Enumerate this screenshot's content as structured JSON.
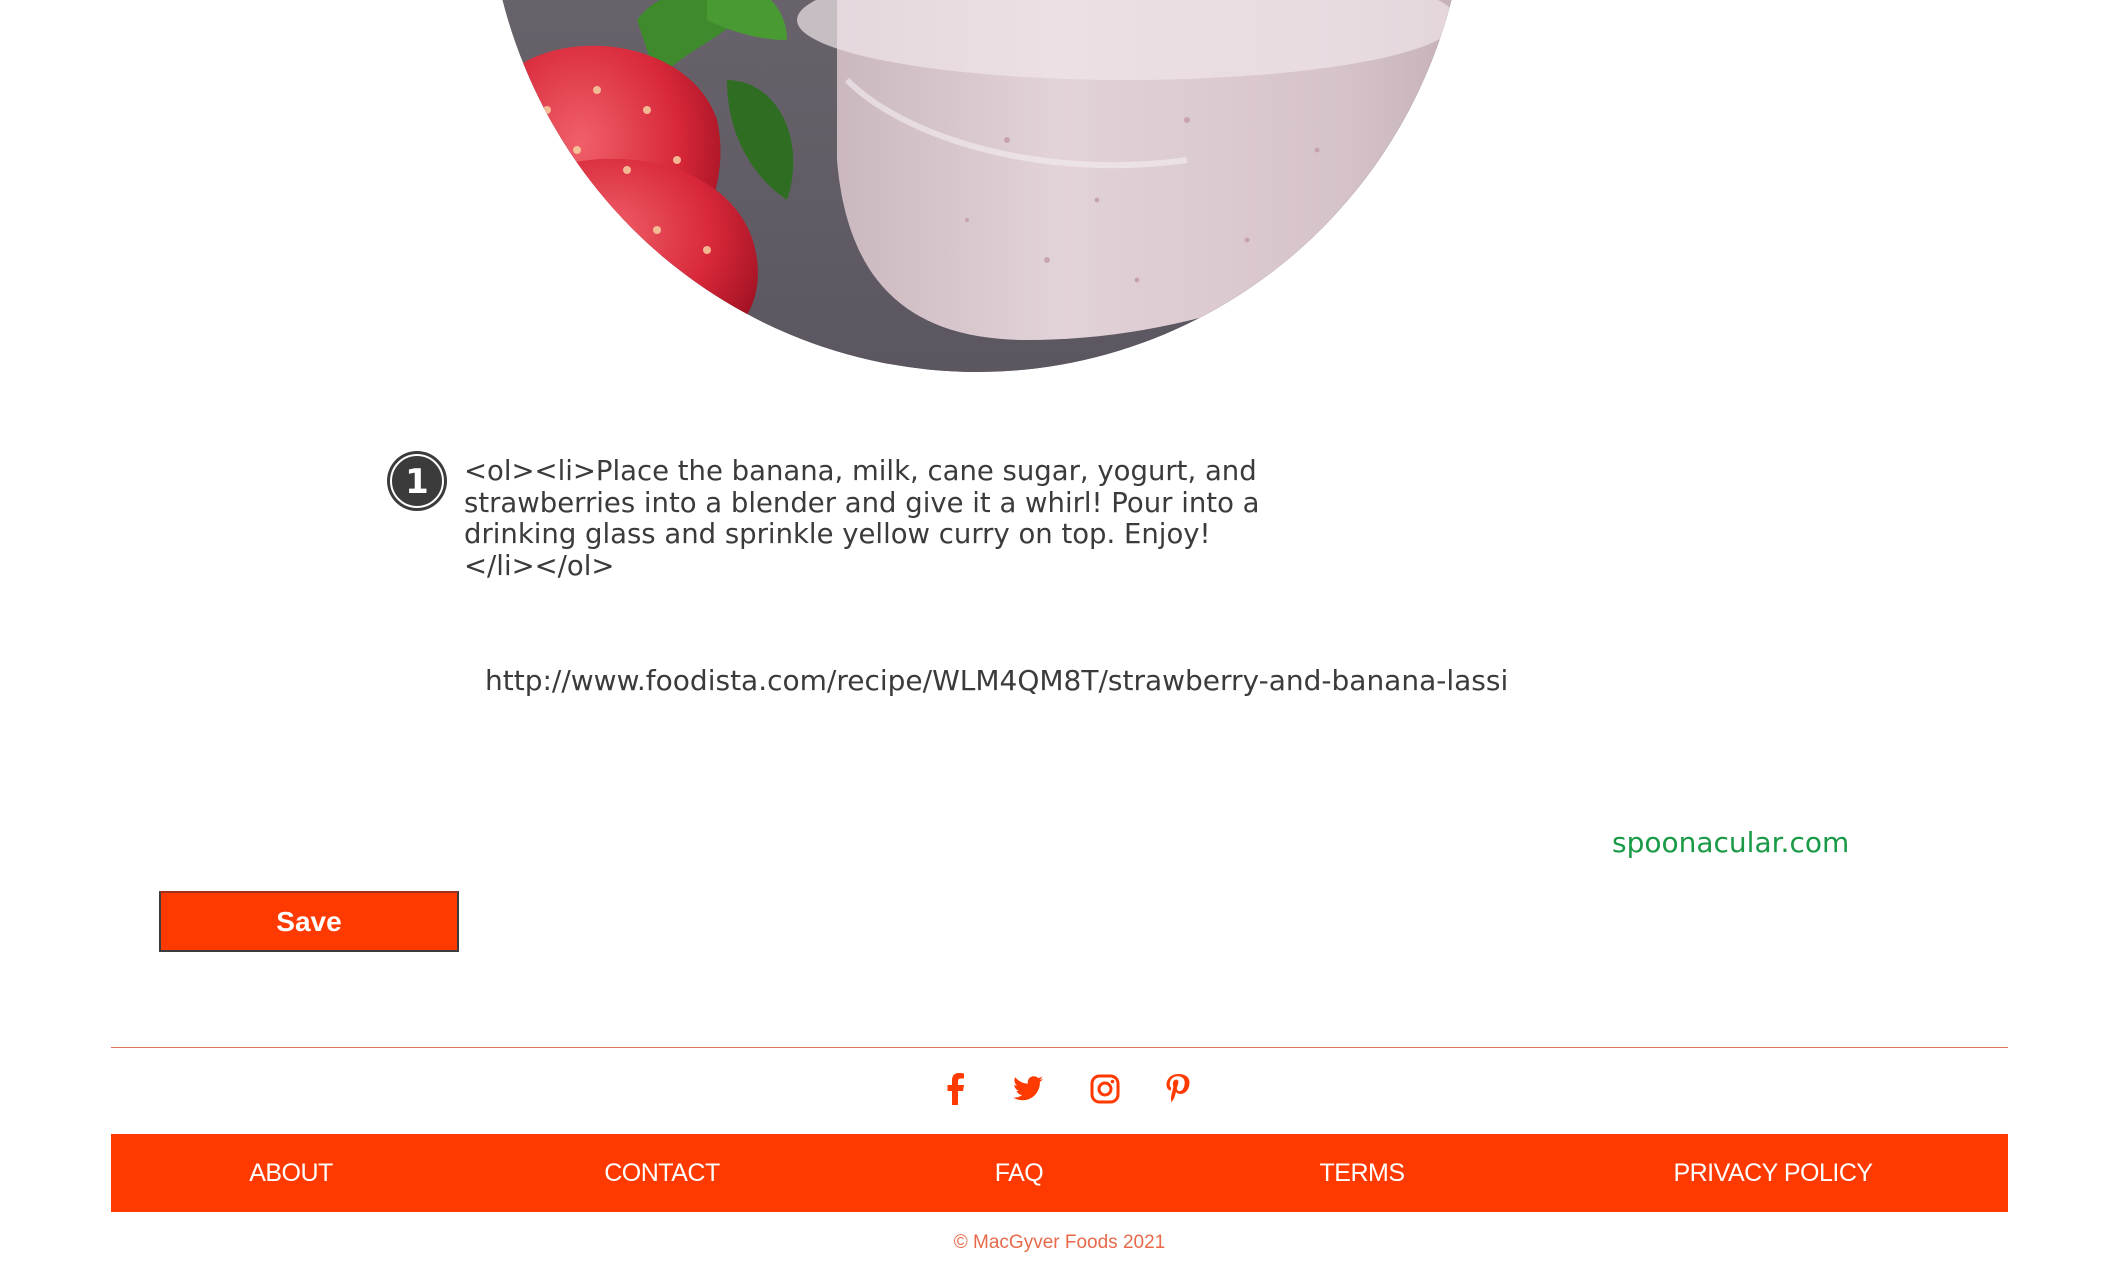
{
  "recipe": {
    "image_alt": "Strawberry and Banana Lassi",
    "step": {
      "number": "1",
      "text": "<ol><li>Place the banana, milk, cane sugar, yogurt, and strawberries into a blender and give it a whirl! Pour into a drinking glass and sprinkle yellow curry on top. Enjoy!</li></ol>"
    },
    "source_url": "http://www.foodista.com/recipe/WLM4QM8T/strawberry-and-banana-lassi",
    "credit": "spoonacular.com",
    "save_label": "Save"
  },
  "footer": {
    "social": [
      {
        "icon": "facebook-icon"
      },
      {
        "icon": "twitter-icon"
      },
      {
        "icon": "instagram-icon"
      },
      {
        "icon": "pinterest-icon"
      }
    ],
    "nav": {
      "about": "ABOUT",
      "contact": "CONTACT",
      "faq": "FAQ",
      "terms": "TERMS",
      "privacy": "PRIVACY POLICY"
    },
    "copyright": "© MacGyver Foods 2021"
  },
  "colors": {
    "accent": "#ff3a00",
    "credit_green": "#1a9a46",
    "text_dark": "#3b3b3b"
  }
}
